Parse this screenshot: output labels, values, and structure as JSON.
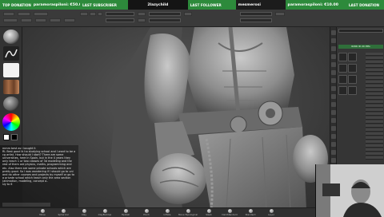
{
  "overlay": {
    "top_donation_tag": "TOP DONATION",
    "top_donation_value": "paramoraspiloni: €50.00",
    "last_subscriber_tag": "LAST SUBSCRIBER",
    "last_subscriber_value": "2lazychild",
    "last_follower_tag": "LAST FOLLOWER",
    "last_follower_value": "mesmerosi",
    "last_donation_tag": "LAST DONATION",
    "last_donation_value": "paramoraspiloni: €10.00"
  },
  "right_panel": {
    "history_label": "6266 ID 20 PPG"
  },
  "chat": {
    "lines": [
      {
        "user": "",
        "text": "mmm best as i bought it"
      },
      {
        "user": "",
        "text": "RL Best good ik ha studying school and I want to be a cg artist. How should I start? There are some universities, here in Spain, but in the 4 years they only teach 1 or two classes of 3d modeling and the rest of them are physics, maths, programming and etc. Also there are some private schools which are pretty good. So I was wondering if I should go to uni and do other courses and projects by myself or go to a private school which teach only the area section (animation, modeling, concept a.."
      },
      {
        "user": "",
        "text": "sly to 6"
      }
    ]
  },
  "shelf": {
    "items": [
      "Move",
      "Spherical",
      "Clay",
      "ClayBuildup",
      "Hpolish",
      "Pinch",
      "Inflate",
      "Move Topological",
      "Slash",
      "DamStandard",
      "Standard",
      "Layer"
    ]
  }
}
